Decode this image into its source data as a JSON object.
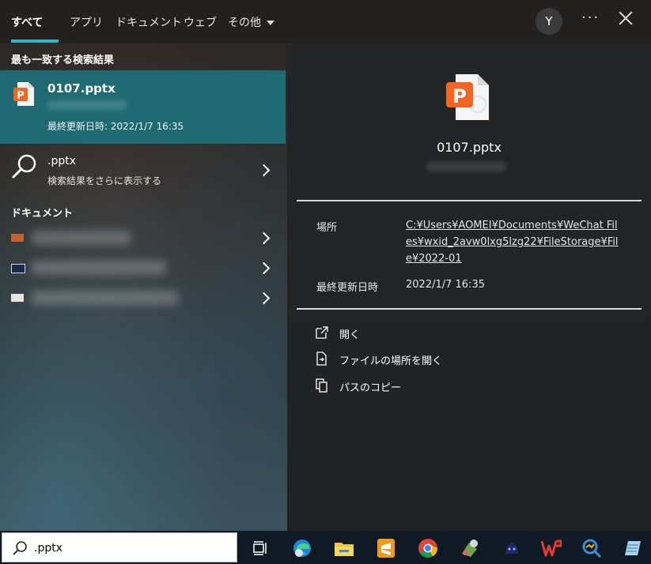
{
  "tabs": [
    {
      "label": "すべて"
    },
    {
      "label": "アプリ"
    },
    {
      "label": "ドキュメント"
    },
    {
      "label": "ウェブ"
    },
    {
      "label": "その他"
    }
  ],
  "header": {
    "avatar_initial": "Y",
    "more_label": "···"
  },
  "best_match": {
    "section_title": "最も一致する検索結果",
    "file_name": "0107.pptx",
    "modified": "最終更新日時: 2022/1/7 16:35"
  },
  "web_search": {
    "query": ".pptx",
    "subtitle": "検索結果をさらに表示する"
  },
  "documents": {
    "section_title": "ドキュメント"
  },
  "detail": {
    "file_name": "0107.pptx",
    "location_label": "場所",
    "location_value": "C:¥Users¥AOMEI¥Documents¥WeChat Files¥wxid_2avw0lxg5lzg22¥FileStorage¥File¥2022-01",
    "modified_label": "最終更新日時",
    "modified_value": "2022/1/7 16:35",
    "actions": [
      {
        "label": "開く",
        "icon": "open-icon"
      },
      {
        "label": "ファイルの場所を開く",
        "icon": "file-location-icon"
      },
      {
        "label": "パスのコピー",
        "icon": "copy-path-icon"
      }
    ]
  },
  "taskbar": {
    "search_value": ".pptx",
    "icons": [
      "task-view-icon",
      "edge-icon",
      "file-explorer-icon",
      "sublime-text-icon",
      "chrome-icon",
      "app-icon",
      "game-icon",
      "wps-office-icon",
      "search-app-icon",
      "notepad-icon"
    ]
  },
  "colors": {
    "accent": "#2fb7c8",
    "selected_row": "#1f6a73",
    "pptx_orange": "#f26522"
  }
}
